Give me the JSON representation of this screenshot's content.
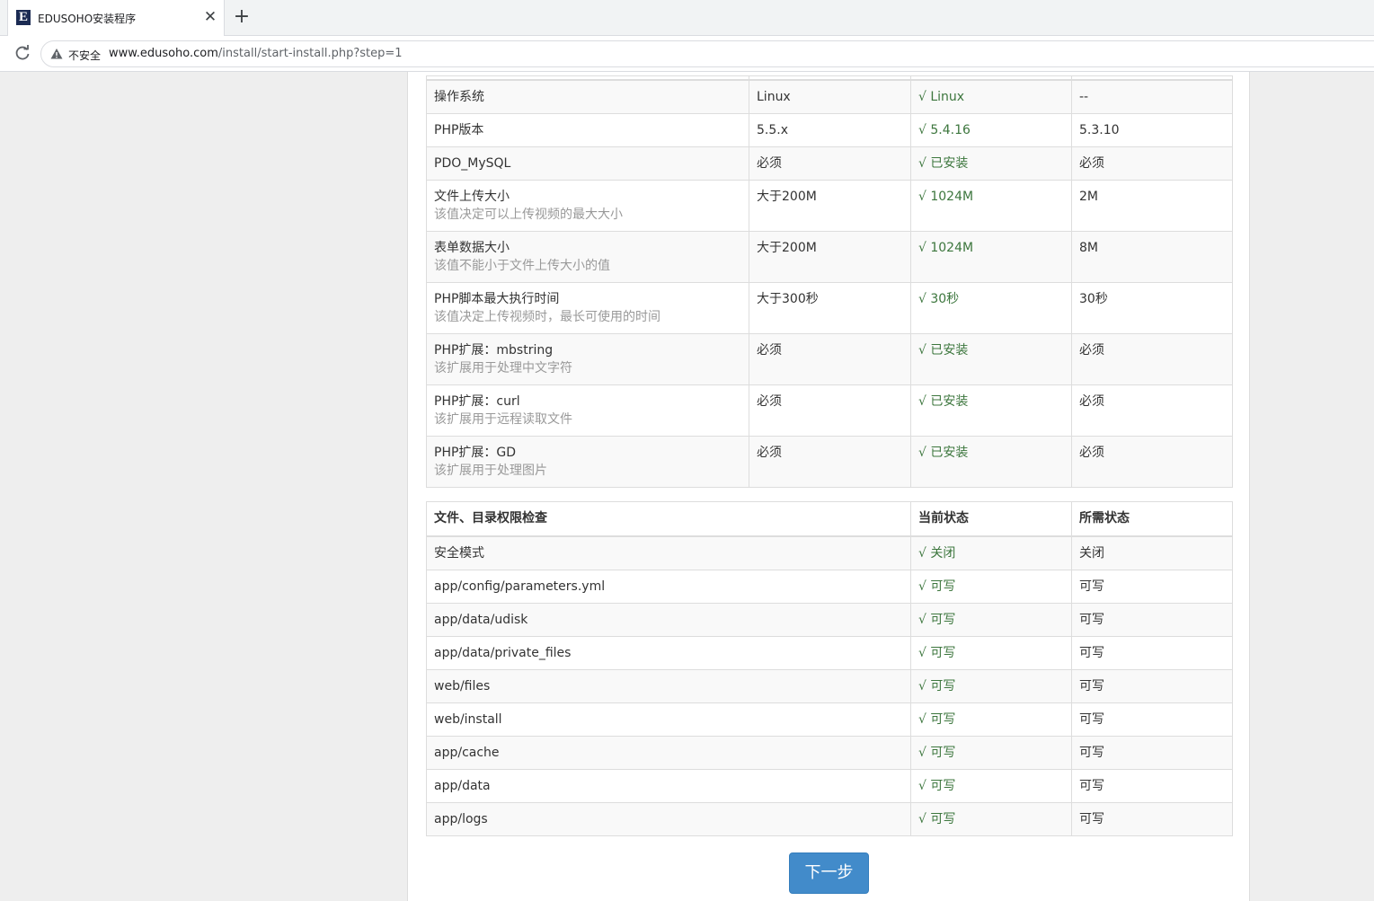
{
  "browser": {
    "tab_title": "EDUSOHO安装程序",
    "favicon_letter": "E",
    "close_symbol": "✕",
    "new_tab_symbol": "+",
    "security_label": "不安全",
    "url_host": "www.edusoho.com",
    "url_path": "/install/start-install.php?step=1"
  },
  "env_table": {
    "rows": [
      {
        "name": "操作系统",
        "hint": "",
        "recommended": "Linux",
        "current": "√ Linux",
        "required": "--"
      },
      {
        "name": "PHP版本",
        "hint": "",
        "recommended": "5.5.x",
        "current": "√ 5.4.16",
        "required": "5.3.10"
      },
      {
        "name": "PDO_MySQL",
        "hint": "",
        "recommended": "必须",
        "current": "√ 已安装",
        "required": "必须"
      },
      {
        "name": "文件上传大小",
        "hint": "该值决定可以上传视频的最大大小",
        "recommended": "大于200M",
        "current": "√ 1024M",
        "required": "2M"
      },
      {
        "name": "表单数据大小",
        "hint": "该值不能小于文件上传大小的值",
        "recommended": "大于200M",
        "current": "√ 1024M",
        "required": "8M"
      },
      {
        "name": "PHP脚本最大执行时间",
        "hint": "该值决定上传视频时，最长可使用的时间",
        "recommended": "大于300秒",
        "current": "√ 30秒",
        "required": "30秒"
      },
      {
        "name": "PHP扩展：mbstring",
        "hint": "该扩展用于处理中文字符",
        "recommended": "必须",
        "current": "√ 已安装",
        "required": "必须"
      },
      {
        "name": "PHP扩展：curl",
        "hint": "该扩展用于远程读取文件",
        "recommended": "必须",
        "current": "√ 已安装",
        "required": "必须"
      },
      {
        "name": "PHP扩展：GD",
        "hint": "该扩展用于处理图片",
        "recommended": "必须",
        "current": "√ 已安装",
        "required": "必须"
      }
    ]
  },
  "perm_table": {
    "headers": {
      "item": "文件、目录权限检查",
      "current": "当前状态",
      "required": "所需状态"
    },
    "rows": [
      {
        "path": "安全模式",
        "current": "√ 关闭",
        "required": "关闭"
      },
      {
        "path": "app/config/parameters.yml",
        "current": "√ 可写",
        "required": "可写"
      },
      {
        "path": "app/data/udisk",
        "current": "√ 可写",
        "required": "可写"
      },
      {
        "path": "app/data/private_files",
        "current": "√ 可写",
        "required": "可写"
      },
      {
        "path": "web/files",
        "current": "√ 可写",
        "required": "可写"
      },
      {
        "path": "web/install",
        "current": "√ 可写",
        "required": "可写"
      },
      {
        "path": "app/cache",
        "current": "√ 可写",
        "required": "可写"
      },
      {
        "path": "app/data",
        "current": "√ 可写",
        "required": "可写"
      },
      {
        "path": "app/logs",
        "current": "√ 可写",
        "required": "可写"
      }
    ]
  },
  "next_button": "下一步",
  "colors": {
    "ok_green": "#3c763d",
    "button_blue": "#428bca",
    "hint_gray": "#999999"
  }
}
